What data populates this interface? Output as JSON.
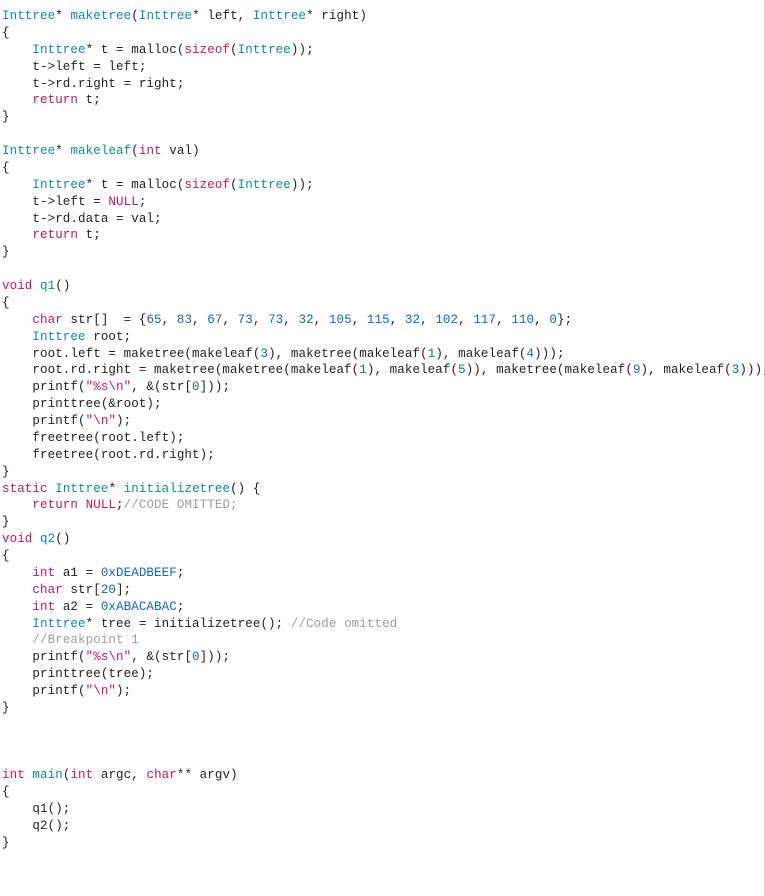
{
  "code": {
    "maketree_sig_type": "Inttree",
    "maketree_sig_star": "*",
    "maketree_name": "maketree",
    "maketree_params_open": "(",
    "maketree_p1_type": "Inttree",
    "maketree_p1_name": "* left, ",
    "maketree_p2_type": "Inttree",
    "maketree_p2_name": "* right)",
    "lbrace": "{",
    "rbrace": "}",
    "indent": "    ",
    "maketree_l1_a": "Inttree",
    "maketree_l1_b": "* t = malloc(",
    "sizeof": "sizeof",
    "maketree_l1_c": "(",
    "maketree_l1_d": "Inttree",
    "maketree_l1_e": "));",
    "maketree_l2": "t->left = left;",
    "maketree_l3": "t->rd.right = right;",
    "return_kw": "return",
    "maketree_l4": " t;",
    "makeleaf_name": "makeleaf",
    "makeleaf_params_a": "(",
    "int_kw": "int",
    "makeleaf_params_b": " val)",
    "makeleaf_l2a": "t->left = ",
    "null_kw": "NULL",
    "makeleaf_l2b": ";",
    "makeleaf_l3": "t->rd.data = val;",
    "void_kw": "void",
    "q1_name": "q1",
    "parens": "()",
    "char_kw": "char",
    "q1_l1a": " str[]  = {",
    "n65": "65",
    "n83": "83",
    "n67": "67",
    "n73": "73",
    "n32": "32",
    "n105": "105",
    "n115": "115",
    "n102": "102",
    "n117": "117",
    "n110": "110",
    "n0": "0",
    "comma": ", ",
    "q1_l1b": "};",
    "q1_l2_a": "Inttree",
    "q1_l2_b": " root;",
    "q1_l3a": "root.left = maketree(makeleaf(",
    "n3": "3",
    "n1": "1",
    "n4": "4",
    "n5": "5",
    "n9": "9",
    "q1_l3b": "), maketree(makeleaf(",
    "q1_l3c": "), makeleaf(",
    "q1_l3d": ")));",
    "q1_l4a": "root.rd.right = maketree(maketree(makeleaf(",
    "q1_l4b": "), makeleaf(",
    "q1_l4c": ")), maketree(makeleaf(",
    "q1_l4d": "), makeleaf(",
    "q1_l4e": ")));",
    "q1_l5a": "printf(",
    "str_fmt": "\"%s\\n\"",
    "q1_l5b": ", &(str[",
    "q1_l5c": "]));",
    "q1_l6": "printtree(&root);",
    "q1_l7a": "printf(",
    "str_nl": "\"\\n\"",
    "q1_l7b": ");",
    "q1_l8": "freetree(root.left);",
    "q1_l9": "freetree(root.rd.right);",
    "static_kw": "static",
    "inittree_name": "initializetree",
    "inittree_paren": "() {",
    "inittree_ret": " ",
    "inittree_semi": ";",
    "inittree_comment": "//CODE OMITTED;",
    "q2_name": "q2",
    "q2_l1a": " a1 = ",
    "hex1": "0xDEADBEEF",
    "q2_l1b": ";",
    "q2_l2a": " str[",
    "n20": "20",
    "q2_l2b": "];",
    "q2_l3a": " a2 = ",
    "hex2": "0xABACABAC",
    "q2_l3b": ";",
    "q2_l4a": "Inttree",
    "q2_l4b": "* tree = initializetree(); ",
    "q2_l4c": "//Code omitted",
    "q2_bp": "//Breakpoint 1",
    "q2_l5a": "printf(",
    "q2_l5b": ", &(str[",
    "q2_l5c": "]));",
    "q2_l6": "printtree(tree);",
    "q2_l7a": "printf(",
    "q2_l7b": ");",
    "main_name": "main",
    "main_params_a": "(",
    "main_params_b": " argc, ",
    "main_params_c": "** argv)",
    "main_l1": "q1();",
    "main_l2": "q2();"
  }
}
